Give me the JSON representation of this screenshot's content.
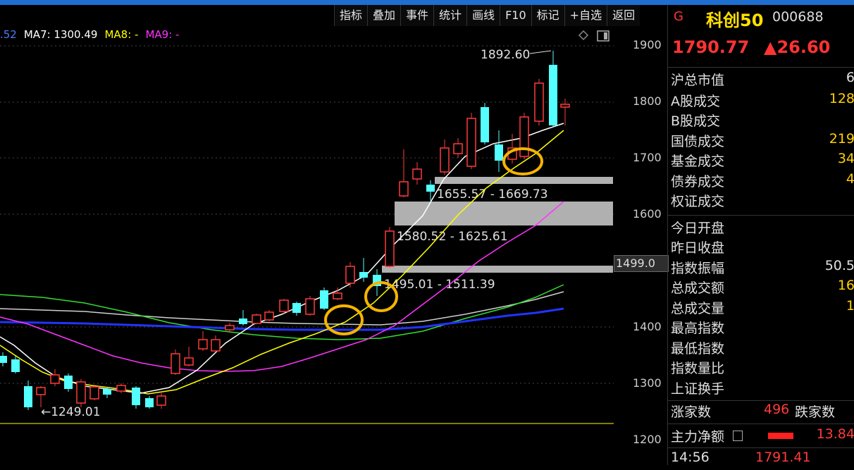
{
  "toolbar": {
    "items": [
      "指标",
      "叠加",
      "事件",
      "统计",
      "画线",
      "F10",
      "标记",
      "+自选",
      "返回"
    ]
  },
  "legend": {
    "ma6_tail": ".52",
    "ma7": "MA7: 1300.49",
    "ma8": "MA8: -",
    "ma9": "MA9: -"
  },
  "chart": {
    "y_ticks": [
      "1900",
      "1800",
      "1700",
      "1600",
      "1400",
      "1300",
      "1200"
    ],
    "current_price_tag": "1499.0",
    "high_label": "1892.60",
    "low_label": "←1249.01",
    "zones": [
      {
        "label": "1655.57 - 1669.73"
      },
      {
        "label": "1580.52 - 1625.61"
      },
      {
        "label": "1495.01 - 1511.39"
      }
    ],
    "colors": {
      "up": "#ff3b3b",
      "down": "#54ffff",
      "ma_white": "#ffffff",
      "ma_yellow": "#ffff00",
      "ma_magenta": "#ff33ff",
      "ma_green": "#33dd33",
      "ma_blue": "#2233ff",
      "ma_gray": "#dddddd",
      "zone": "#b0b0b0",
      "circle": "#f5b400"
    }
  },
  "panel": {
    "icon": "G",
    "name": "科创50",
    "code": "000688",
    "price": "1790.77",
    "change": "▲26.60",
    "rows_a": [
      {
        "label": "沪总市值",
        "value": "6"
      },
      {
        "label": "A股成交",
        "value": "128"
      },
      {
        "label": "B股成交",
        "value": ""
      },
      {
        "label": "国债成交",
        "value": "219"
      },
      {
        "label": "基金成交",
        "value": "34"
      },
      {
        "label": "债券成交",
        "value": "4"
      },
      {
        "label": "权证成交",
        "value": ""
      }
    ],
    "rows_b": [
      {
        "label": "今日开盘",
        "value": ""
      },
      {
        "label": "昨日收盘",
        "value": ""
      },
      {
        "label": "指数振幅",
        "value": "50.5"
      },
      {
        "label": "总成交额",
        "value": "16"
      },
      {
        "label": "总成交量",
        "value": "1"
      },
      {
        "label": "最高指数",
        "value": ""
      },
      {
        "label": "最低指数",
        "value": ""
      },
      {
        "label": "指数量比",
        "value": ""
      },
      {
        "label": "上证换手",
        "value": ""
      }
    ],
    "advancers_label": "涨家数",
    "advancers_value": "496",
    "decliners_label": "跌家数",
    "net_flow_label": "主力净额",
    "net_flow_value": "13.84",
    "time": "14:56",
    "time_value": "1791.41"
  }
}
